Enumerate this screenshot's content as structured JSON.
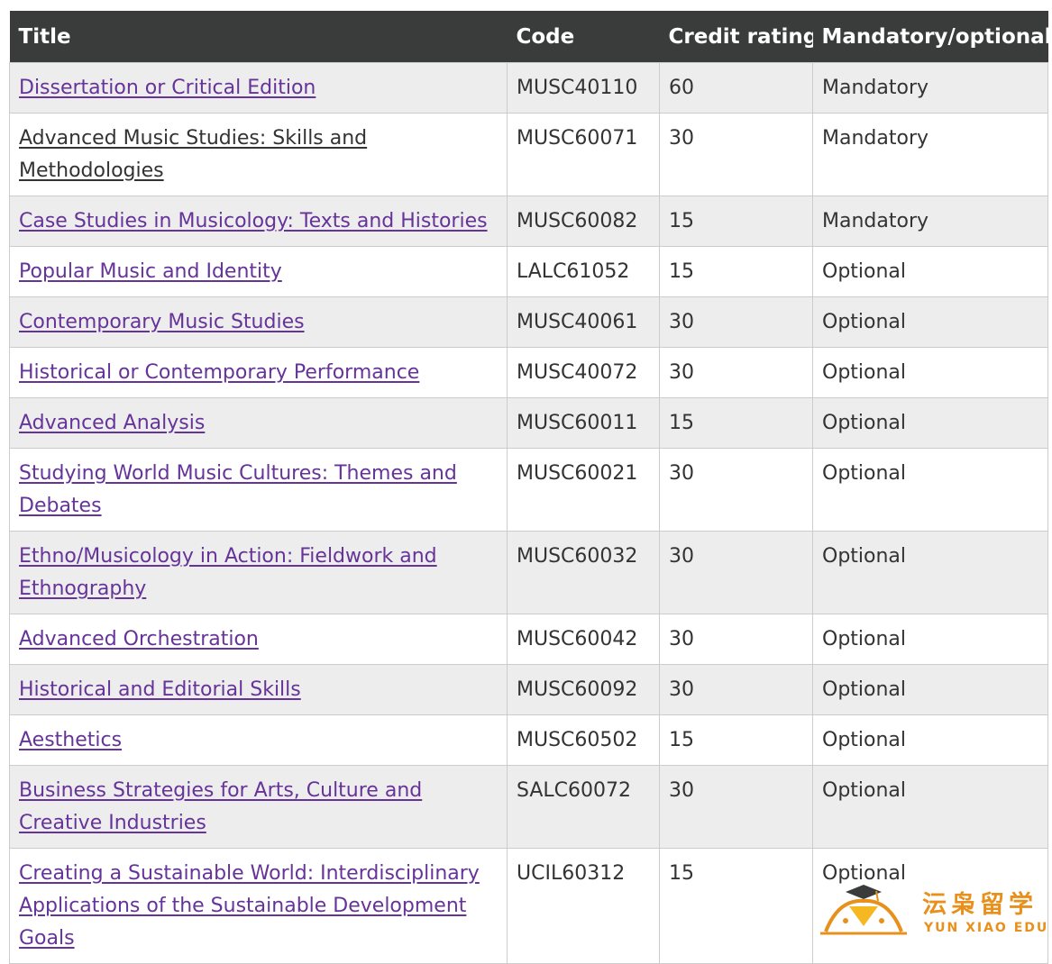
{
  "table": {
    "headers": [
      "Title",
      "Code",
      "Credit rating",
      "Mandatory/optional"
    ],
    "rows": [
      {
        "title": "Dissertation or Critical Edition",
        "code": "MUSC40110",
        "credit": "60",
        "status": "Mandatory"
      },
      {
        "title": "Advanced Music Studies: Skills and Methodologies",
        "code": "MUSC60071",
        "credit": "30",
        "status": "Mandatory"
      },
      {
        "title": "Case Studies in Musicology: Texts and Histories",
        "code": "MUSC60082",
        "credit": "15",
        "status": "Mandatory"
      },
      {
        "title": "Popular Music and Identity",
        "code": "LALC61052",
        "credit": "15",
        "status": "Optional"
      },
      {
        "title": "Contemporary Music Studies",
        "code": "MUSC40061",
        "credit": "30",
        "status": "Optional"
      },
      {
        "title": "Historical or Contemporary Performance",
        "code": "MUSC40072",
        "credit": "30",
        "status": "Optional"
      },
      {
        "title": "Advanced Analysis",
        "code": "MUSC60011",
        "credit": "15",
        "status": "Optional"
      },
      {
        "title": "Studying World Music Cultures: Themes and Debates",
        "code": "MUSC60021",
        "credit": "30",
        "status": "Optional"
      },
      {
        "title": "Ethno/Musicology in Action: Fieldwork and Ethnography",
        "code": "MUSC60032",
        "credit": "30",
        "status": "Optional"
      },
      {
        "title": "Advanced Orchestration",
        "code": "MUSC60042",
        "credit": "30",
        "status": "Optional"
      },
      {
        "title": "Historical and Editorial Skills",
        "code": "MUSC60092",
        "credit": "30",
        "status": "Optional"
      },
      {
        "title": "Aesthetics",
        "code": "MUSC60502",
        "credit": "15",
        "status": "Optional"
      },
      {
        "title": "Business Strategies for Arts, Culture and Creative Industries",
        "code": "SALC60072",
        "credit": "30",
        "status": "Optional"
      },
      {
        "title": "Creating a Sustainable World: Interdisciplinary Applications of the Sustainable Development Goals",
        "code": "UCIL60312",
        "credit": "15",
        "status": "Optional"
      }
    ]
  },
  "watermark": {
    "chinese": "沄枭留学",
    "english": "YUN XIAO EDU"
  },
  "colors": {
    "header_bg": "#3a3c3b",
    "link": "#663399",
    "visited_link": "#333333",
    "shaded_row": "#ededed",
    "logo": "#e8901c"
  }
}
